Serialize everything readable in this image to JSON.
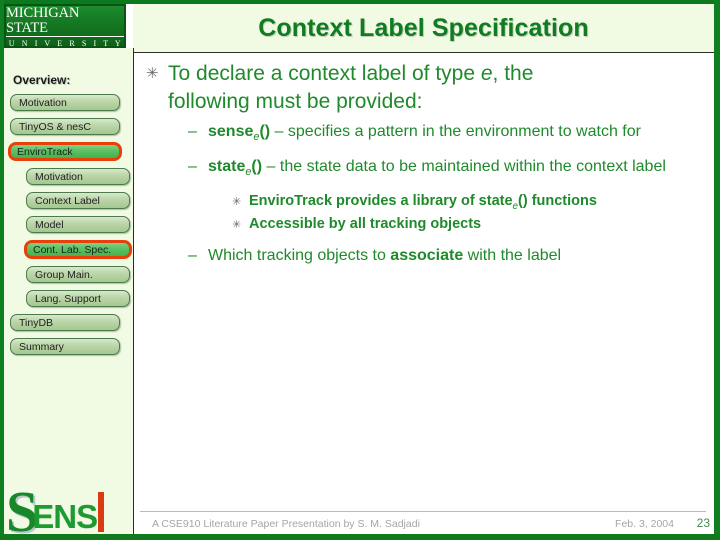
{
  "slide": {
    "title": "Context Label Specification",
    "accent_green": "#1f8a2b",
    "title_green": "#107c21",
    "highlight_red": "#e8400d",
    "panel_bg": "#f1fae3"
  },
  "logo": {
    "msu_line1": "MICHIGAN STATE",
    "msu_line2": "U N I V E R S I T Y",
    "sens_s": "S",
    "sens_rest": "ENS"
  },
  "sidebar": {
    "heading": "Overview:",
    "items": [
      {
        "label": "Motivation",
        "level": 1,
        "highlighted": false
      },
      {
        "label": "TinyOS & nesC",
        "level": 1,
        "highlighted": false
      },
      {
        "label": "EnviroTrack",
        "level": 1,
        "highlighted": true
      },
      {
        "label": "Motivation",
        "level": 2,
        "highlighted": false
      },
      {
        "label": "Context Label",
        "level": 2,
        "highlighted": false
      },
      {
        "label": "Model",
        "level": 2,
        "highlighted": false
      },
      {
        "label": "Cont. Lab. Spec.",
        "level": 2,
        "highlighted": true
      },
      {
        "label": "Group Main.",
        "level": 2,
        "highlighted": false
      },
      {
        "label": "Lang. Support",
        "level": 2,
        "highlighted": false
      },
      {
        "label": "TinyDB",
        "level": 1,
        "highlighted": false
      },
      {
        "label": "Summary",
        "level": 1,
        "highlighted": false
      }
    ]
  },
  "content": {
    "bullet1_mark": "✳",
    "bullet2_mark": "–",
    "bullet3_mark": "✳",
    "lead": "To declare a context label of type e, the following must be provided:",
    "sense_name": "sense",
    "sense_sub": "e",
    "sense_parens": "()",
    "sense_desc": "– specifies a pattern in the environment to watch for",
    "state_name": "state",
    "state_sub": "e",
    "state_parens": "()",
    "state_desc": "– the state data to be maintained within the context label",
    "sub1_pre": "EnviroTrack provides a library of state",
    "sub1_sub": "e",
    "sub1_post": "() functions",
    "sub2": "Accessible by all tracking objects",
    "assoc_pre": "Which tracking objects to ",
    "assoc_kw": "associate",
    "assoc_post": " with the label"
  },
  "footer": {
    "credit": "A CSE910 Literature Paper Presentation by S. M. Sadjadi",
    "date": "Feb. 3, 2004",
    "page": "23"
  }
}
